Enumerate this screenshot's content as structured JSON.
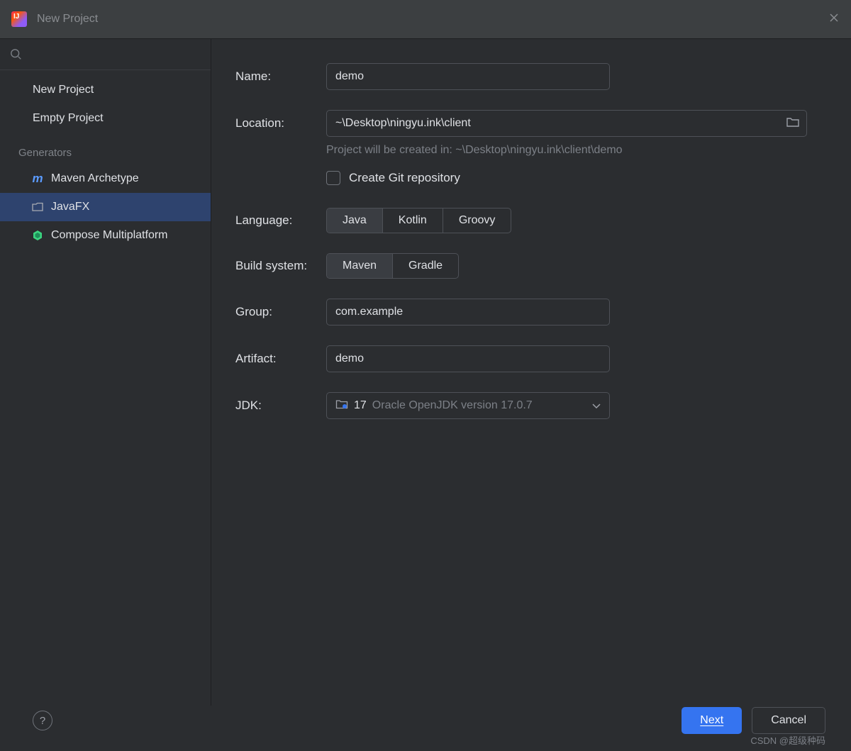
{
  "window": {
    "title": "New Project"
  },
  "sidebar": {
    "items": [
      {
        "label": "New Project"
      },
      {
        "label": "Empty Project"
      }
    ],
    "generators_header": "Generators",
    "generators": [
      {
        "label": "Maven Archetype",
        "icon": "maven"
      },
      {
        "label": "JavaFX",
        "icon": "folder",
        "selected": true
      },
      {
        "label": "Compose Multiplatform",
        "icon": "compose"
      }
    ]
  },
  "form": {
    "name_label": "Name:",
    "name_value": "demo",
    "location_label": "Location:",
    "location_value": "~\\Desktop\\ningyu.ink\\client",
    "location_hint": "Project will be created in: ~\\Desktop\\ningyu.ink\\client\\demo",
    "git_checkbox_label": "Create Git repository",
    "git_checked": false,
    "language_label": "Language:",
    "language_options": [
      "Java",
      "Kotlin",
      "Groovy"
    ],
    "language_selected": "Java",
    "build_label": "Build system:",
    "build_options": [
      "Maven",
      "Gradle"
    ],
    "build_selected": "Maven",
    "group_label": "Group:",
    "group_value": "com.example",
    "artifact_label": "Artifact:",
    "artifact_value": "demo",
    "jdk_label": "JDK:",
    "jdk_version": "17",
    "jdk_desc": "Oracle OpenJDK version 17.0.7"
  },
  "footer": {
    "next": "Next",
    "cancel": "Cancel"
  },
  "watermark": "CSDN @超级种码"
}
